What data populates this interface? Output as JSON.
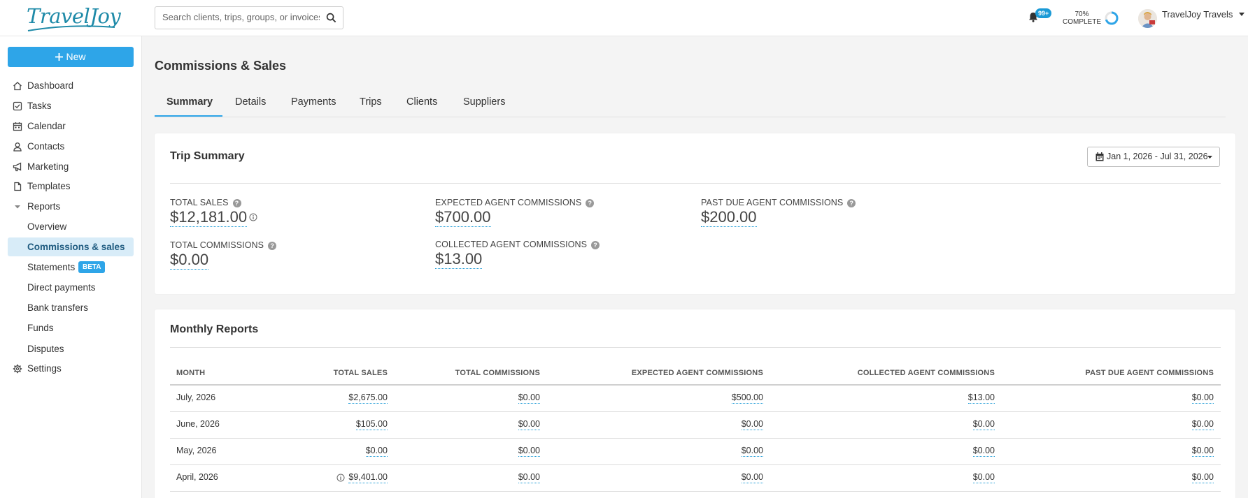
{
  "app": {
    "logo_text": "TravelJoy",
    "search_placeholder": "Search clients, trips, groups, or invoices...",
    "notifications_badge": "99+",
    "profile_progress_percent": "70%",
    "profile_progress_label": "COMPLETE",
    "profile_progress_value": 0.7,
    "user_name": "TravelJoy Travels"
  },
  "sidebar": {
    "new_button": "New",
    "items": [
      {
        "label": "Dashboard",
        "icon": "home-icon"
      },
      {
        "label": "Tasks",
        "icon": "checkbox-icon"
      },
      {
        "label": "Calendar",
        "icon": "calendar-icon"
      },
      {
        "label": "Contacts",
        "icon": "person-icon"
      },
      {
        "label": "Marketing",
        "icon": "megaphone-icon"
      },
      {
        "label": "Templates",
        "icon": "document-icon"
      },
      {
        "label": "Reports",
        "icon": "caret-down-icon"
      }
    ],
    "report_items": [
      {
        "label": "Overview"
      },
      {
        "label": "Commissions & sales",
        "active": true
      },
      {
        "label": "Statements",
        "badge": "BETA"
      },
      {
        "label": "Direct payments"
      },
      {
        "label": "Bank transfers"
      },
      {
        "label": "Funds"
      },
      {
        "label": "Disputes"
      }
    ],
    "settings": {
      "label": "Settings",
      "icon": "gear-icon"
    }
  },
  "page": {
    "title": "Commissions & Sales",
    "tabs": [
      "Summary",
      "Details",
      "Payments",
      "Trips",
      "Clients",
      "Suppliers"
    ],
    "active_tab": "Summary"
  },
  "trip_summary": {
    "title": "Trip Summary",
    "date_range": "Jan 1, 2026 - Jul 31, 2026",
    "metrics": {
      "total_sales": {
        "label": "TOTAL SALES",
        "value": "$12,181.00"
      },
      "total_commissions": {
        "label": "TOTAL COMMISSIONS",
        "value": "$0.00"
      },
      "expected_agent_commissions": {
        "label": "EXPECTED AGENT COMMISSIONS",
        "value": "$700.00"
      },
      "collected_agent_commissions": {
        "label": "COLLECTED AGENT COMMISSIONS",
        "value": "$13.00"
      },
      "past_due_agent_commissions": {
        "label": "PAST DUE AGENT COMMISSIONS",
        "value": "$200.00"
      }
    }
  },
  "monthly_reports": {
    "title": "Monthly Reports",
    "columns": [
      "MONTH",
      "TOTAL SALES",
      "TOTAL COMMISSIONS",
      "EXPECTED AGENT COMMISSIONS",
      "COLLECTED AGENT COMMISSIONS",
      "PAST DUE AGENT COMMISSIONS"
    ],
    "rows": [
      {
        "month": "July, 2026",
        "total_sales": "$2,675.00",
        "total_commissions": "$0.00",
        "expected": "$500.00",
        "collected": "$13.00",
        "past_due": "$0.00"
      },
      {
        "month": "June, 2026",
        "total_sales": "$105.00",
        "total_commissions": "$0.00",
        "expected": "$0.00",
        "collected": "$0.00",
        "past_due": "$0.00"
      },
      {
        "month": "May, 2026",
        "total_sales": "$0.00",
        "total_commissions": "$0.00",
        "expected": "$0.00",
        "collected": "$0.00",
        "past_due": "$0.00"
      },
      {
        "month": "April, 2026",
        "total_sales": "$9,401.00",
        "total_commissions": "$0.00",
        "expected": "$0.00",
        "collected": "$0.00",
        "past_due": "$0.00"
      }
    ]
  },
  "colors": {
    "accent": "#2ea5e8",
    "logo": "#1e8aa8",
    "active_nav_bg": "#d8ecf8"
  }
}
